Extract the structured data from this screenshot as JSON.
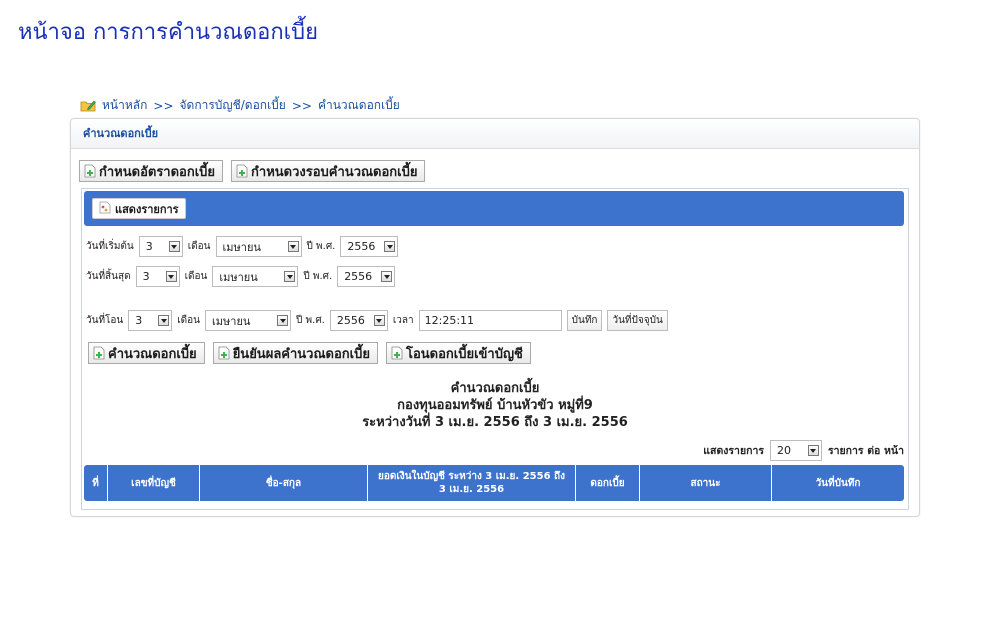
{
  "page": {
    "title": "หน้าจอ การการคำนวณดอกเบี้ย"
  },
  "breadcrumb": {
    "home": "หน้าหลัก",
    "sep1": ">>",
    "section": "จัดการบัญชี/ดอกเบี้ย",
    "sep2": ">>",
    "current": "คำนวณดอกเบี้ย"
  },
  "panel": {
    "header": "คำนวณดอกเบี้ย",
    "buttons": {
      "set_rate": "กำหนดอัตราดอกเบี้ย",
      "set_cycle": "กำหนดวงรอบคำนวณดอกเบี้ย"
    }
  },
  "tab": {
    "show_list": "แสดงรายการ"
  },
  "form": {
    "start": {
      "label": "วันที่เริ่มต้น",
      "day": "3",
      "month_label": "เดือน",
      "month": "เมษายน",
      "year_label": "ปี พ.ศ.",
      "year": "2556"
    },
    "end": {
      "label": "วันที่สิ้นสุด",
      "day": "3",
      "month_label": "เดือน",
      "month": "เมษายน",
      "year_label": "ปี พ.ศ.",
      "year": "2556"
    },
    "transfer": {
      "label": "วันที่โอน",
      "day": "3",
      "month_label": "เดือน",
      "month": "เมษายน",
      "year_label": "ปี พ.ศ.",
      "year": "2556",
      "time_label": "เวลา",
      "time": "12:25:11",
      "save": "บันทึก",
      "today": "วันที่ปัจจุบัน"
    }
  },
  "actions": {
    "calculate": "คำนวณดอกเบี้ย",
    "confirm": "ยืนยันผลคำนวณดอกเบี้ย",
    "transfer": "โอนดอกเบี้ยเข้าบัญชี"
  },
  "report": {
    "line1": "คำนวณดอกเบี้ย",
    "line2": "กองทุนออมทรัพย์ บ้านหัวขัว หมู่ที่9",
    "line3": "ระหว่างวันที่ 3 เม.ย. 2556 ถึง 3 เม.ย. 2556"
  },
  "paging": {
    "prefix": "แสดงรายการ",
    "per_page": "20",
    "suffix": "รายการ ต่อ หน้า"
  },
  "table": {
    "columns": [
      "ที่",
      "เลขที่บัญชี",
      "ชื่อ-สกุล",
      "ยอดเงินในบัญชี ระหว่าง 3 เม.ย. 2556 ถึง 3 เม.ย. 2556",
      "ดอกเบี้ย",
      "สถานะ",
      "วันที่บันทึก"
    ]
  },
  "colors": {
    "title": "#1a2fb8",
    "link": "#1c4e9c",
    "bar": "#3d73cd"
  },
  "icons": {
    "home": "folder-pencil-icon",
    "doc": "document-add-icon"
  }
}
